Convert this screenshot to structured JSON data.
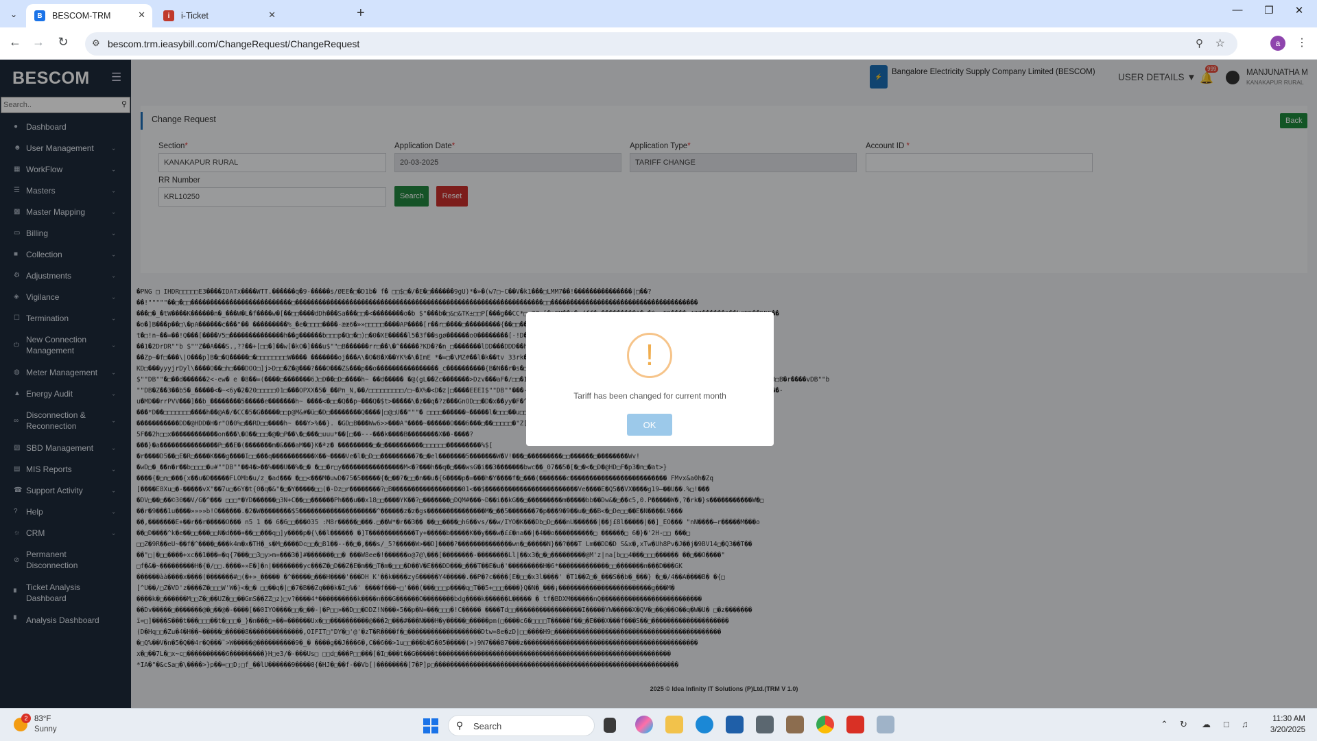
{
  "browser": {
    "tabs": [
      {
        "title": "BESCOM-TRM",
        "active": true
      },
      {
        "title": "i-Ticket",
        "active": false
      }
    ],
    "url": "bescom.trm.ieasybill.com/ChangeRequest/ChangeRequest",
    "profile_initial": "a"
  },
  "sidebar": {
    "brand": "BESCOM",
    "search_placeholder": "Search..",
    "items": [
      {
        "label": "Dashboard",
        "icon": "palette-icon",
        "has_children": false
      },
      {
        "label": "User Management",
        "icon": "user-icon",
        "has_children": true
      },
      {
        "label": "WorkFlow",
        "icon": "workflow-icon",
        "has_children": true
      },
      {
        "label": "Masters",
        "icon": "list-icon",
        "has_children": true
      },
      {
        "label": "Master Mapping",
        "icon": "map-icon",
        "has_children": true
      },
      {
        "label": "Billing",
        "icon": "monitor-icon",
        "has_children": true
      },
      {
        "label": "Collection",
        "icon": "collection-icon",
        "has_children": true
      },
      {
        "label": "Adjustments",
        "icon": "adjust-icon",
        "has_children": true
      },
      {
        "label": "Vigilance",
        "icon": "vigilance-icon",
        "has_children": true
      },
      {
        "label": "Termination",
        "icon": "termination-icon",
        "has_children": true
      },
      {
        "label": "New Connection Management",
        "icon": "connection-icon",
        "has_children": true
      },
      {
        "label": "Meter Management",
        "icon": "meter-icon",
        "has_children": true
      },
      {
        "label": "Energy Audit",
        "icon": "audit-icon",
        "has_children": true
      },
      {
        "label": "Disconnection & Reconnection",
        "icon": "link-icon",
        "has_children": true
      },
      {
        "label": "SBD Management",
        "icon": "sbd-icon",
        "has_children": true
      },
      {
        "label": "MIS Reports",
        "icon": "report-icon",
        "has_children": true
      },
      {
        "label": "Support Activity",
        "icon": "support-icon",
        "has_children": true
      },
      {
        "label": "Help",
        "icon": "help-icon",
        "has_children": true
      },
      {
        "label": "CRM",
        "icon": "crm-icon",
        "has_children": true
      },
      {
        "label": "Permanent Disconnection",
        "icon": "disconnect-icon",
        "has_children": false
      },
      {
        "label": "Ticket Analysis Dashboard",
        "icon": "chart-icon",
        "has_children": false
      },
      {
        "label": "Analysis Dashboard",
        "icon": "chart-icon",
        "has_children": false
      }
    ]
  },
  "header": {
    "company": "Bangalore Electricity Supply Company Limited (BESCOM)",
    "user_details": "USER DETAILS",
    "notification_count": "999",
    "user_name": "MANJUNATHA M",
    "user_location": "KANAKAPUR RURAL"
  },
  "form": {
    "title": "Change Request",
    "back_label": "Back",
    "section_label": "Section",
    "section_value": "KANAKAPUR RURAL",
    "app_date_label": "Application Date",
    "app_date_value": "20-03-2025",
    "app_type_label": "Application Type",
    "app_type_value": "TARIFF CHANGE",
    "account_label": "Account ID",
    "account_value": "",
    "rr_label": "RR Number",
    "rr_value": "KRL10250",
    "search_label": "Search",
    "reset_label": "Reset"
  },
  "garbled_output": [
    "�PNG □ IHDR□□□□□E3����IDATx����WTT.������q�9-�����s/ØEE�□�D1b� f� □□$□�/�E�□������9gU)*�»�(w7□~C��V�k1���□LMM7��!���������������|□��?",
    "��!\"\"\"\"\"��□�□□��������������������������□����������������������������������������������������������������□□��������������������������������������",
    "���□�_�tW����K������n�_���W�L�f����w�[�­�□□����dDh���Sa���□□�<��������o�b $\"���b�□&□&TK±□□P[���g��CC*□ 77□[�nFM��a�□dff�□���������^�w�^□□F9����:477������O��k@DD��DDD��",
    "�o�]B���p��□\\�pA������c���\"��  ���������%_�e�□□□□����-ææ6�»»□□□□□����AP����[r��r□����□���������{��□□����K����?",
    "t�□!n~��=��!Q���[����V5□��������������h��g������b□□□p�Q□�□)□�0�XE�����l5�3f��sgø������o0��������[-!D��©e�0�G���m�]�_����e]���!��oe�6�u2�^��!�l{rR0���?�U���[",
    "��1�2DrDR\"\"b $\"\"Z��A���S.,??��+[□□�]��w[�kO�]���u$\"\"□B������rr□��\\�^�����?KD�?�n_□�������lDD���DDD��hl!�□□>���□?��s���-d}�����G�□��G�022�kDD���DDD��eTv�<}",
    "��Zp~�f□���\\|O���p]B�□�Q�����□�□□□□□□□□W���� �������oj���A\\�O�8�X��YK%�\\�ImE *�=□�\\MZ#��l�k��tv 33rk�������p��Q����1�□□□□!□��������E�*����@{|□□N�D�VUq�\\X��",
    "KD□���yyyjrDyl\\����O��□h□���DOO□]j>D□□�Z�@���?���O���Z&���p��o����������������_c����������{B�N��r�s�□�]�z�� ��%���&��I6��������������PN�\"��e����W�□���������#d",
    "$\"\"DB\"\"�□��d������2<-ew� e �8��=(����□�������6J□D��□D□����h~ ��d����� �@(gL��Zc�������>Dzv���aF�/□□�1�rD�M^ \"\"b $\"\"□B□�������-[�]X����������? □���D\"\"b $\"\"□B□H>]�□h�3□B�r����vDB\"\"b",
    "\"\"DB�Z��3��b5�_�����<�~<6y�2�20□□□□□01□���OPXX�5�_��Pn_N,��/□□□□□□□□□/□~�X%�<D�z|□����EEEI$\"\"DB\"\"���-�n\\�\\�]N����Q��g������□□bbbpD�����JJJ~H�U �o�[�g�D□�@HDD4» ���O��-",
    "u�MD��rrPVV���]��b_��������5�����e�������h~ ����<�□□�Q��p~���Q�$t>�����\\�z��q�?z���GnOD□□�D�x��yy�F�^□\"□b $\"��=��z&yll□c���+?����l_E4##��□□]�DD6�eT9N����",
    "���*D��□□□□□□□����h��@A�/�CC�5�G�����□□p@M&#�ü□�D□��������Q����|□@□U��\"\"\"� □□□□������~�����l�□□□��u□□□□□□□�7������^�□����1]�b�□e□□□�□□�-/□",
    "�����������DD�@HDD�H�r\"O�0%□��RD□□����h~ ���Y>%��}. �GD□B���Ww6>>���A\"����~������O���6���□��□□□□□�\"Z[[�o��>5�n����<D�□��~��N□�Z□q�□���□��",
    "5F��2h□□x������������on���\\�O��□□□�@�□P��\\�□���□uuu*��[□��---���k����B��������X��-����?",
    "���}�a���������������P□��E�(�������m�&���aM��}K�ªz� ���������□�□����������□□□□□□���������%$[",
    "�r����D5��□E�R□����K���g����I□□���q�����������X��~����Ve�l�□D□□���������7�□�el�������5�������W�V!���□���������□□������□��������Wv!",
    "�wD□�_��n�r��b□□□□�u#\"\"DB\"\"��4�>��%���U��%�□� �□□�r□y����������������M<�?���h��q�□���wsG�i��3�������bwc��_07��5�[�□�<�□D�@HD□F�p3�n□�at>}",
    "����{�□n□���{x��u�D�����FLOMb�u/z_�ad��� �□□<���M�uwD�75�5�����{�□��?�□□�n��u�{6����p�=���h�Y����f�□���(�������c������������������������� FMvx&a0h�Zq",
    "[����E8Xu□�-�����vX\"��7u□�6Y�t{0�q�&\"�□�Y�����□□(�-Dz□r��������?□B������������������01<��$������������������������Ve����E�Q5��VX����g19—��U��.%□!���",
    "�DV□��□��©30��V/G�^��� □□□*�YD������□3N+C��□□������Ph���u��x18□□����YK��?□�������□DQM#���~D��i��kG��□���������m�����bb��Dw&�□��c5,0.P�����W�,?�rk�}s�����������W�□",
    "��r�9���1u����»»»»b!O������.�2�W��������$5��������������������^������z�z�gs���������������M�□��5�������7�p���9�9��u�□��B<�□De□□��E�N����L9���",
    "��,�������E+��r��r�����O���  n5 1 �� 6�6□□���035 :M8r�����□���.□��W*�r��3�� ��□□����□h6��vs/��w/IYO�K���Db□D□���nU������|��j£8l�����|��]_EO��� \"nN����—r�����M���o",
    "��□D����^k�e��□□���□□N�d���+��□□���q□]y����p�{\\��l������ �]T������������Ty+�����b�����K��y���w�££�na��|�4��o����������□ ������□ 6�}�'2H-□□ ���□",
    "□□Z�9R��eU~��f�^����□���k4m�x�TH�_s�M□����Dc□□�□B1��--��□�,���s/_5?�����W>��D]����?��������������wn�□�����N}��?���Т Lm��DD�D S&x�,xTw�Uh8Pv�J��j�9BV14□�Q3��T��",
    "��\"□|�□□����+xc��1���=�q{7���□□3□y>m=���3�]#�������□□� ���W8ee�!������o@7@\\���[��������-��������Ll|��x3�□�□���������@M'z|na[b□□4���□□□������ ��□��O����\"",
    "□f�&�~���������H�{�/□□.����»»E�]�n|��������ус���Z�□D��Z�E�m��□T�m�□□□�D��V�E���DD���□���T��E�u�'���������H�6*�������������□□�������n���D���GK",
    "������àà����x����(�������#□(�+»_����� �^�����□���H����'���DH K'��k����zy6�����Y4�����.��P�?c����[E�□□�x3l����' �T1��Z□�_���S��b�_���} �□�/4��A����B� �{□",
    "[^U��/□Z�VD'z����Z�□□□W'W�}<�□� □□��q�|□�7�B��Zq���k�I□%�' ����f���~□'���(���□□□p����q□T��5+□□□����}Q�N�_���¡������������������������g���M�",
    "����k�□������M□□Z�□��UZ�□□��GmS��ZZ□z)□v?����4*����������k����n���G������O��������bdg����k������L����� � tf�BDXM������nQ��������������������������",
    "��Dv�����□�������@�□��@�-����[��0IYO����□□�□��-|�P□□»��D□□�DDZ!N���»5��p�N=���□□□�!C����� ����Td□□�����������������I�����YW�����X�QV�□��@��O��q�W�U� □�z�������",
    "ï=□]����S���t���□□□��t�□□□�_}�n���□+��=������Ux�□□����������@���2□���#���N���H�y�����□�����pm(□����c6�□□□□T�����f��□�E���X���f���S��□��������������������",
    "(D�Hq□□�Zu�4�H��~�����□�����8��������������,OIFIT□\"DY�□'@'�zT�R����f�□�������������������Dtw=8e�zD|□□����H9□�������������������������������������������",
    "�□Q%��V�n�5�Q��4r�Q���¨>W�����@����������9�_� ����g��J���6�,C��6��>1u□□���b�5�05�����(>)9N7���87���z���������������������������������������������",
    "x�□��7L�□x~c□����������6���������}H□e3/�-���Us□ □□d□���P□□���[�I□���t��G�����t������������������������������������������������������������",
    "*IA�\"�&cSa□�\\����>}p��=□□D;□f_��lU������9����0{�HJ�□��f-��Vb[)��������[7�P]p□���������������������������������������������������������������"
  ],
  "footer": "2025 © Idea Infinity IT Solutions (P)Ltd.(TRM V 1.0)",
  "modal": {
    "message": "Tariff has been changed for current month",
    "ok_label": "OK"
  },
  "taskbar": {
    "weather_badge": "2",
    "temperature": "83°F",
    "condition": "Sunny",
    "search_label": "Search",
    "time": "11:30 AM",
    "date": "3/20/2025"
  }
}
